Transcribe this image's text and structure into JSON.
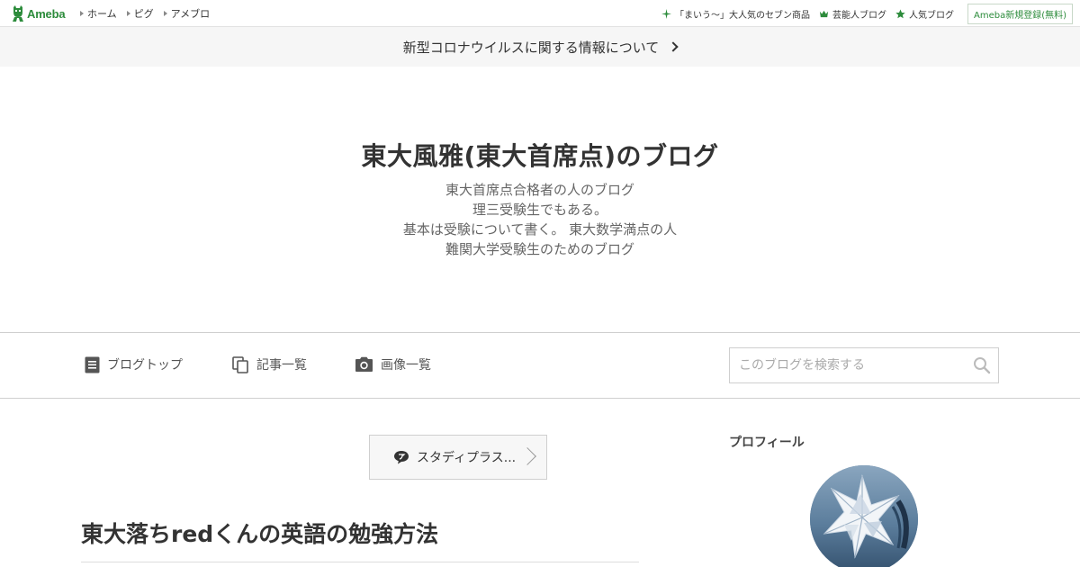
{
  "topbar": {
    "logo_text": "Ameba",
    "nav": [
      {
        "label": "ホーム"
      },
      {
        "label": "ピグ"
      },
      {
        "label": "アメブロ"
      }
    ],
    "right_links": [
      {
        "label": "「まいう～」大人気のセブン商品",
        "icon": "sparkle-icon"
      },
      {
        "label": "芸能人ブログ",
        "icon": "crown-icon"
      },
      {
        "label": "人気ブログ",
        "icon": "star-icon"
      }
    ],
    "register_label": "Ameba新規登録(無料)",
    "accent_color": "#2d8c3c"
  },
  "notice": {
    "text": "新型コロナウイルスに関する情報について"
  },
  "blog": {
    "title": "東大風雅(東大首席点)のブログ",
    "description_lines": [
      "東大首席点合格者の人のブログ",
      "理三受験生でもある。",
      "基本は受験について書く。 東大数学満点の人",
      "難関大学受験生のためのブログ"
    ]
  },
  "menu": {
    "items": [
      {
        "label": "ブログトップ",
        "icon": "document-icon"
      },
      {
        "label": "記事一覧",
        "icon": "copy-icon"
      },
      {
        "label": "画像一覧",
        "icon": "camera-icon"
      }
    ],
    "search_placeholder": "このブログを検索する"
  },
  "main": {
    "genre_label": "スタディプラス...",
    "entry_title": "東大落ちredくんの英語の勉強方法"
  },
  "sidebar": {
    "profile_heading": "プロフィール"
  }
}
